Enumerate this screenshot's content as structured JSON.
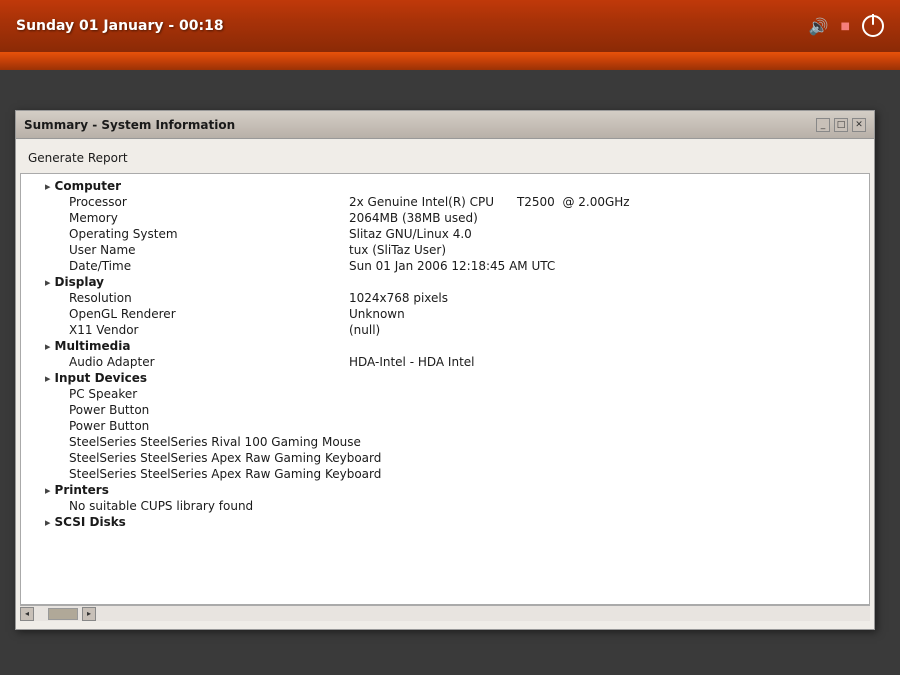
{
  "desktop": {
    "background_color": "#3a3a3a"
  },
  "top_panel": {
    "datetime": "Sunday 01 January - 00:18",
    "icons": {
      "volume": "🔊",
      "power": "⏻"
    }
  },
  "window": {
    "title": "Summary - System Information",
    "controls": {
      "minimize": "_",
      "restore": "□",
      "close": "✕"
    },
    "generate_report_label": "Generate Report",
    "sections": [
      {
        "name": "Computer",
        "expanded": true,
        "indent": 1,
        "children": [
          {
            "label": "Processor",
            "value": "2x Genuine Intel(R) CPU     T2500  @ 2.00GHz",
            "indent": 2
          },
          {
            "label": "Memory",
            "value": "2064MB (38MB used)",
            "indent": 2
          },
          {
            "label": "Operating System",
            "value": "Slitaz GNU/Linux 4.0",
            "indent": 2
          },
          {
            "label": "User Name",
            "value": "tux (SliTaz User)",
            "indent": 2
          },
          {
            "label": "Date/Time",
            "value": "Sun 01 Jan 2006 12:18:45 AM UTC",
            "indent": 2
          }
        ]
      },
      {
        "name": "Display",
        "expanded": true,
        "indent": 1,
        "children": [
          {
            "label": "Resolution",
            "value": "1024x768 pixels",
            "indent": 2
          },
          {
            "label": "OpenGL Renderer",
            "value": "Unknown",
            "indent": 2
          },
          {
            "label": "X11 Vendor",
            "value": "(null)",
            "indent": 2
          }
        ]
      },
      {
        "name": "Multimedia",
        "expanded": true,
        "indent": 1,
        "children": [
          {
            "label": "Audio Adapter",
            "value": "HDA-Intel - HDA Intel",
            "indent": 2
          }
        ]
      },
      {
        "name": "Input Devices",
        "expanded": true,
        "indent": 1,
        "children": [
          {
            "label": "PC Speaker",
            "value": "",
            "indent": 2
          },
          {
            "label": "Power Button",
            "value": "",
            "indent": 2
          },
          {
            "label": "Power Button",
            "value": "",
            "indent": 2
          },
          {
            "label": "SteelSeries SteelSeries Rival 100 Gaming Mouse",
            "value": "",
            "indent": 2
          },
          {
            "label": "SteelSeries SteelSeries Apex Raw Gaming Keyboard",
            "value": "",
            "indent": 2
          },
          {
            "label": "SteelSeries SteelSeries Apex Raw Gaming Keyboard",
            "value": "",
            "indent": 2
          }
        ]
      },
      {
        "name": "Printers",
        "expanded": true,
        "indent": 1,
        "children": [
          {
            "label": "No suitable CUPS library found",
            "value": "",
            "indent": 2
          }
        ]
      },
      {
        "name": "SCSI Disks",
        "expanded": false,
        "indent": 1,
        "children": []
      }
    ]
  }
}
